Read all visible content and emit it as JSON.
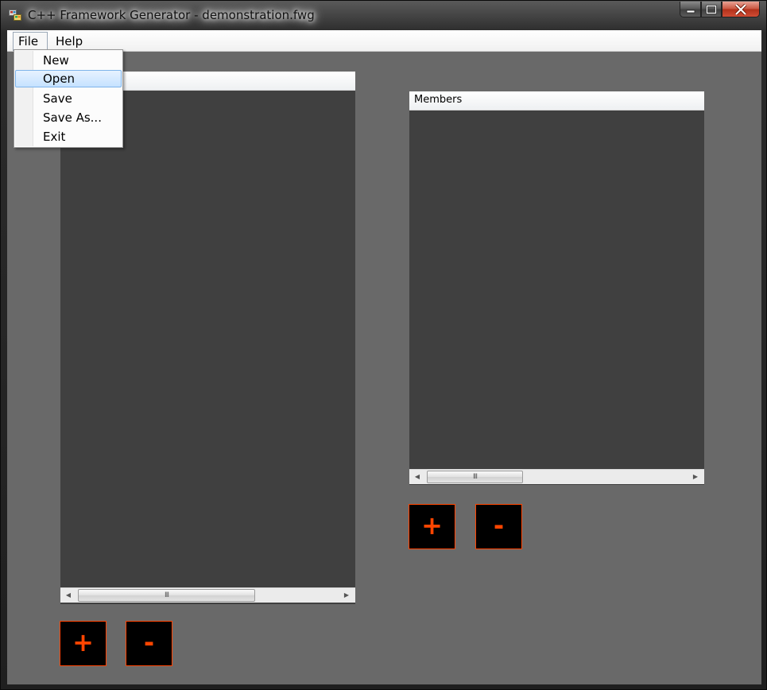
{
  "window": {
    "title": "C++ Framework Generator - demonstration.fwg"
  },
  "menubar": {
    "file": "File",
    "help": "Help"
  },
  "file_menu": {
    "items": [
      "New",
      "Open",
      "Save",
      "Save As...",
      "Exit"
    ],
    "highlighted": "Open"
  },
  "left_panel": {
    "header": "",
    "add_label": "+",
    "remove_label": "-"
  },
  "members_panel": {
    "header": "Members",
    "add_label": "+",
    "remove_label": "-"
  },
  "scrollbar": {
    "grip": "III"
  },
  "colors": {
    "client_bg": "#696969",
    "panel_bg": "#404040",
    "accent": "#ff4500",
    "button_bg": "#000000",
    "menu_highlight": "#cce4ff"
  },
  "icons": {
    "app": "app-icon",
    "minimize": "minimize-icon",
    "maximize": "maximize-icon",
    "close": "close-icon",
    "scroll_left": "chevron-left-icon",
    "scroll_right": "chevron-right-icon"
  }
}
